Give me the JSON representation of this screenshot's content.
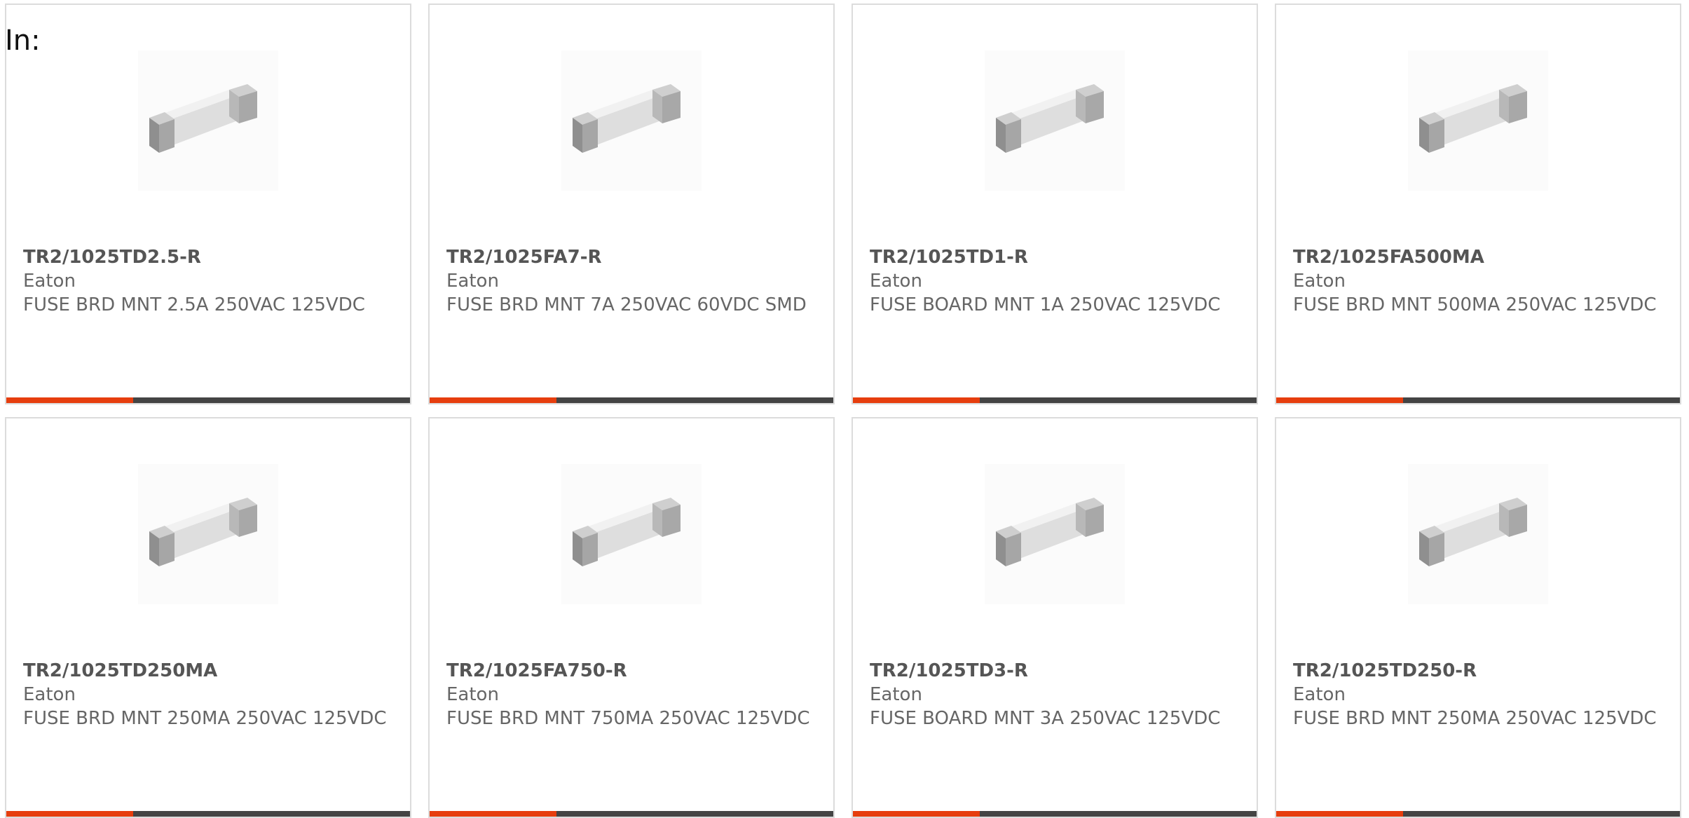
{
  "header": {
    "label": "In:"
  },
  "colors": {
    "accent": "#e63e0e",
    "bar": "#444444"
  },
  "products": [
    {
      "part_number": "TR2/1025TD2.5-R",
      "manufacturer": "Eaton",
      "description": "FUSE BRD MNT 2.5A 250VAC 125VDC",
      "icon": "fuse-image"
    },
    {
      "part_number": "TR2/1025FA7-R",
      "manufacturer": "Eaton",
      "description": "FUSE BRD MNT 7A 250VAC 60VDC SMD",
      "icon": "fuse-image"
    },
    {
      "part_number": "TR2/1025TD1-R",
      "manufacturer": "Eaton",
      "description": "FUSE BOARD MNT 1A 250VAC 125VDC",
      "icon": "fuse-image"
    },
    {
      "part_number": "TR2/1025FA500MA",
      "manufacturer": "Eaton",
      "description": "FUSE BRD MNT 500MA 250VAC 125VDC",
      "icon": "fuse-image"
    },
    {
      "part_number": "TR2/1025TD250MA",
      "manufacturer": "Eaton",
      "description": "FUSE BRD MNT 250MA 250VAC 125VDC",
      "icon": "fuse-image"
    },
    {
      "part_number": "TR2/1025FA750-R",
      "manufacturer": "Eaton",
      "description": "FUSE BRD MNT 750MA 250VAC 125VDC",
      "icon": "fuse-image"
    },
    {
      "part_number": "TR2/1025TD3-R",
      "manufacturer": "Eaton",
      "description": "FUSE BOARD MNT 3A 250VAC 125VDC",
      "icon": "fuse-image"
    },
    {
      "part_number": "TR2/1025TD250-R",
      "manufacturer": "Eaton",
      "description": "FUSE BRD MNT 250MA 250VAC 125VDC",
      "icon": "fuse-image"
    }
  ]
}
